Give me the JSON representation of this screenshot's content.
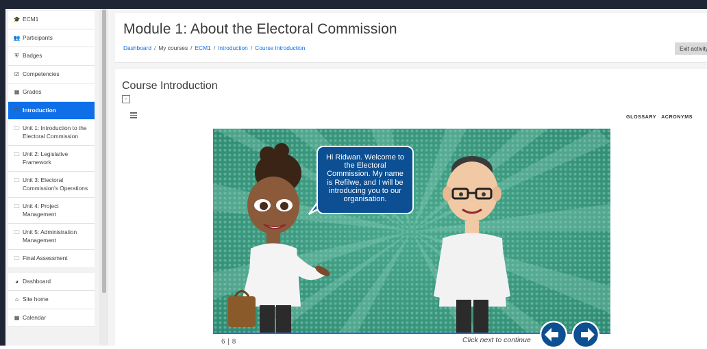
{
  "sidebar": {
    "items": [
      {
        "icon": "graduation-cap-icon",
        "glyph": "🎓",
        "label": "ECM1"
      },
      {
        "icon": "users-icon",
        "glyph": "👥",
        "label": "Participants"
      },
      {
        "icon": "shield-icon",
        "glyph": "⛨",
        "label": "Badges"
      },
      {
        "icon": "checkbox-icon",
        "glyph": "☑",
        "label": "Competencies"
      },
      {
        "icon": "table-icon",
        "glyph": "▦",
        "label": "Grades"
      },
      {
        "icon": "folder-icon",
        "glyph": "🗀",
        "label": "Introduction",
        "active": true
      },
      {
        "icon": "folder-icon",
        "glyph": "🗀",
        "label": "Unit 1: Introduction to the Electoral Commission"
      },
      {
        "icon": "folder-icon",
        "glyph": "🗀",
        "label": "Unit 2: Legislative Framework"
      },
      {
        "icon": "folder-icon",
        "glyph": "🗀",
        "label": "Unit 3: Electoral Commission's Operations"
      },
      {
        "icon": "folder-icon",
        "glyph": "🗀",
        "label": "Unit 4: Project Management"
      },
      {
        "icon": "folder-icon",
        "glyph": "🗀",
        "label": "Unit 5: Administration Management"
      },
      {
        "icon": "folder-icon",
        "glyph": "🗀",
        "label": "Final Assessment"
      },
      {
        "icon": "dashboard-icon",
        "glyph": "◕",
        "label": "Dashboard"
      },
      {
        "icon": "home-icon",
        "glyph": "⌂",
        "label": "Site home"
      },
      {
        "icon": "calendar-icon",
        "glyph": "▦",
        "label": "Calendar"
      }
    ]
  },
  "header": {
    "title": "Module 1: About the Electoral Commission",
    "breadcrumb": [
      {
        "label": "Dashboard",
        "link": true
      },
      {
        "label": "My courses",
        "link": false
      },
      {
        "label": "ECM1",
        "link": true
      },
      {
        "label": "Introduction",
        "link": true
      },
      {
        "label": "Course Introduction",
        "link": true
      }
    ],
    "exit_label": "Exit activity"
  },
  "content": {
    "section_title": "Course Introduction",
    "toggle_glyph": "›",
    "top_links": {
      "glossary": "GLOSSARY",
      "acronyms": "ACRONYMS"
    }
  },
  "player": {
    "speech_bubble": "Hi Ridwan. Welcome to the Electoral Commission. My name is Refilwe, and I will be introducing you to our organisation.",
    "page_counter": "6 | 8",
    "next_hint": "Click next to continue",
    "colors": {
      "background": "#3c9c82",
      "bubble": "#0d4f93",
      "accent": "#2a6fc7"
    }
  }
}
